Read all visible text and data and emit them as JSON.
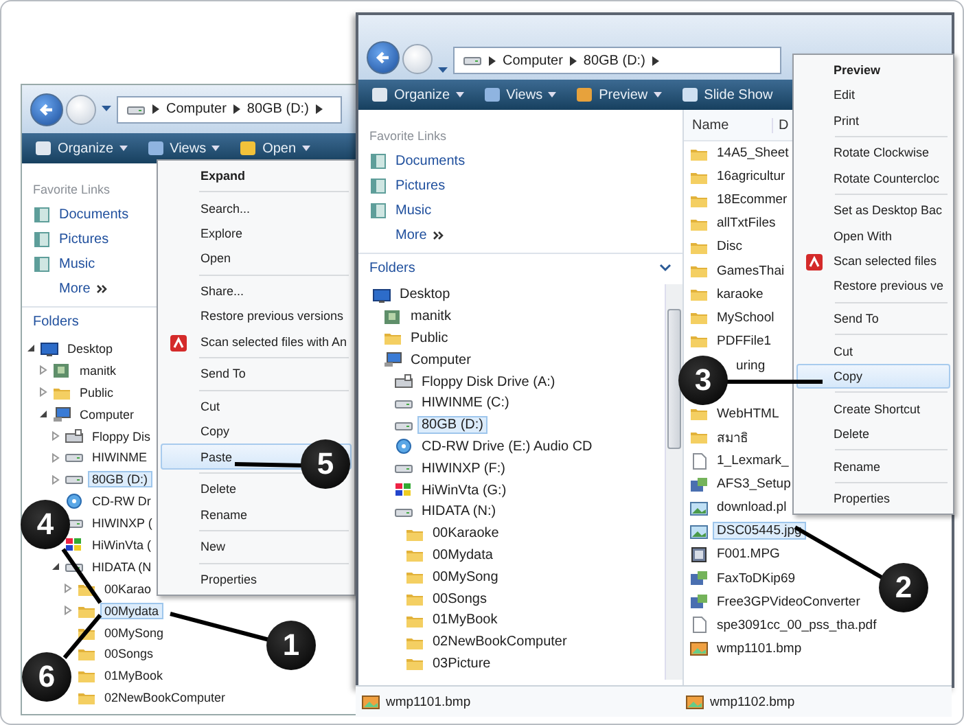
{
  "back_window": {
    "address": [
      "Computer",
      "80GB (D:)"
    ],
    "toolbar": [
      {
        "label": "Organize",
        "kind": "organize"
      },
      {
        "label": "Views",
        "kind": "views"
      },
      {
        "label": "Open",
        "kind": "open"
      }
    ],
    "favorite_links": {
      "title": "Favorite Links",
      "items": [
        "Documents",
        "Pictures",
        "Music"
      ],
      "more": "More"
    },
    "folders_title": "Folders",
    "tree": [
      {
        "label": "Desktop",
        "kind": "desktop",
        "expanded": true,
        "selected": false,
        "children": [
          {
            "label": "manitk",
            "kind": "user",
            "expanded": false,
            "selected": false
          },
          {
            "label": "Public",
            "kind": "folder",
            "expanded": false,
            "selected": false
          },
          {
            "label": "Computer",
            "kind": "computer",
            "expanded": true,
            "selected": false,
            "children": [
              {
                "label": "Floppy Dis",
                "kind": "floppy",
                "expanded": false,
                "selected": false
              },
              {
                "label": "HIWINME",
                "kind": "drive",
                "expanded": false,
                "selected": false
              },
              {
                "label": "80GB (D:)",
                "kind": "drive",
                "expanded": false,
                "selected": true
              },
              {
                "label": "CD-RW Dr",
                "kind": "cd",
                "selected": false
              },
              {
                "label": "HIWINXP (",
                "kind": "drive",
                "selected": false
              },
              {
                "label": "HiWinVta (",
                "kind": "system",
                "selected": false
              },
              {
                "label": "HIDATA (N",
                "kind": "drive",
                "expanded": true,
                "selected": false,
                "children": [
                  {
                    "label": "00Karao",
                    "kind": "folder",
                    "expanded": false,
                    "selected": false
                  },
                  {
                    "label": "00Mydata",
                    "kind": "folder",
                    "expanded": false,
                    "selected": true
                  },
                  {
                    "label": "00MySong",
                    "kind": "folder",
                    "selected": false
                  },
                  {
                    "label": "00Songs",
                    "kind": "folder",
                    "selected": false
                  },
                  {
                    "label": "01MyBook",
                    "kind": "folder",
                    "selected": false
                  },
                  {
                    "label": "02NewBookComputer",
                    "kind": "folder",
                    "selected": false
                  }
                ]
              }
            ]
          }
        ]
      }
    ]
  },
  "back_menu": {
    "groups": [
      [
        {
          "label": "Expand",
          "kind": "default",
          "selected": false
        }
      ],
      [
        {
          "label": "Search...",
          "kind": "plain",
          "selected": false
        },
        {
          "label": "Explore",
          "kind": "plain",
          "selected": false
        },
        {
          "label": "Open",
          "kind": "plain",
          "selected": false
        }
      ],
      [
        {
          "label": "Share...",
          "kind": "plain",
          "selected": false
        },
        {
          "label": "Restore previous versions",
          "kind": "plain",
          "selected": false
        },
        {
          "label": "Scan selected files with An",
          "kind": "scan",
          "selected": false
        }
      ],
      [
        {
          "label": "Send To",
          "kind": "plain",
          "selected": false
        }
      ],
      [
        {
          "label": "Cut",
          "kind": "plain",
          "selected": false
        },
        {
          "label": "Copy",
          "kind": "plain",
          "selected": false
        },
        {
          "label": "Paste",
          "kind": "plain",
          "selected": true
        }
      ],
      [
        {
          "label": "Delete",
          "kind": "plain",
          "selected": false
        },
        {
          "label": "Rename",
          "kind": "plain",
          "selected": false
        }
      ],
      [
        {
          "label": "New",
          "kind": "plain",
          "selected": false
        }
      ],
      [
        {
          "label": "Properties",
          "kind": "plain",
          "selected": false
        }
      ]
    ]
  },
  "front_window": {
    "address": [
      "Computer",
      "80GB (D:)"
    ],
    "toolbar": [
      {
        "label": "Organize",
        "kind": "organize"
      },
      {
        "label": "Views",
        "kind": "views"
      },
      {
        "label": "Preview",
        "kind": "preview"
      },
      {
        "label": "Slide Show",
        "kind": "slideshow"
      }
    ],
    "favorite_links": {
      "title": "Favorite Links",
      "items": [
        "Documents",
        "Pictures",
        "Music"
      ],
      "more": "More"
    },
    "folders_title": "Folders",
    "tree": [
      {
        "label": "Desktop",
        "kind": "desktop",
        "selected": false,
        "children": [
          {
            "label": "manitk",
            "kind": "user",
            "selected": false
          },
          {
            "label": "Public",
            "kind": "folder",
            "selected": false
          },
          {
            "label": "Computer",
            "kind": "computer",
            "selected": false,
            "children": [
              {
                "label": "Floppy Disk Drive (A:)",
                "kind": "floppy",
                "selected": false
              },
              {
                "label": "HIWINME (C:)",
                "kind": "drive",
                "selected": false
              },
              {
                "label": "80GB (D:)",
                "kind": "drive",
                "selected": true
              },
              {
                "label": "CD-RW Drive (E:) Audio CD",
                "kind": "cd",
                "selected": false
              },
              {
                "label": "HIWINXP (F:)",
                "kind": "drive",
                "selected": false
              },
              {
                "label": "HiWinVta (G:)",
                "kind": "system",
                "selected": false
              },
              {
                "label": "HIDATA (N:)",
                "kind": "drive",
                "selected": false,
                "children": [
                  {
                    "label": "00Karaoke",
                    "kind": "folder",
                    "selected": false
                  },
                  {
                    "label": "00Mydata",
                    "kind": "folder",
                    "selected": false
                  },
                  {
                    "label": "00MySong",
                    "kind": "folder",
                    "selected": false
                  },
                  {
                    "label": "00Songs",
                    "kind": "folder",
                    "selected": false
                  },
                  {
                    "label": "01MyBook",
                    "kind": "folder",
                    "selected": false
                  },
                  {
                    "label": "02NewBookComputer",
                    "kind": "folder",
                    "selected": false
                  },
                  {
                    "label": "03Picture",
                    "kind": "folder",
                    "selected": false
                  }
                ]
              }
            ]
          }
        ]
      }
    ],
    "columns": [
      "Name",
      "D"
    ],
    "files": [
      {
        "name": "14A5_Sheet",
        "kind": "folder",
        "selected": false
      },
      {
        "name": "16agricultur",
        "kind": "folder",
        "selected": false
      },
      {
        "name": "18Ecommer",
        "kind": "folder",
        "selected": false
      },
      {
        "name": "allTxtFiles",
        "kind": "folder",
        "selected": false
      },
      {
        "name": "Disc",
        "kind": "folder",
        "selected": false
      },
      {
        "name": "GamesThai",
        "kind": "folder",
        "selected": false
      },
      {
        "name": "karaoke",
        "kind": "folder",
        "selected": false
      },
      {
        "name": "MySchool",
        "kind": "folder",
        "selected": false
      },
      {
        "name": "PDFFile1",
        "kind": "folder",
        "selected": false
      },
      {
        "name": "uring",
        "kind": "covered",
        "selected": false
      },
      {
        "name": "WebHTML",
        "kind": "folder",
        "selected": false
      },
      {
        "name": "สมาธิ",
        "kind": "folder",
        "selected": false
      },
      {
        "name": "1_Lexmark_",
        "kind": "file",
        "selected": false
      },
      {
        "name": "AFS3_Setup",
        "kind": "setup",
        "selected": false
      },
      {
        "name": "download.pl",
        "kind": "image",
        "selected": false
      },
      {
        "name": "DSC05445.jpg",
        "kind": "image",
        "selected": true
      },
      {
        "name": "F001.MPG",
        "kind": "video",
        "selected": false
      },
      {
        "name": "FaxToDKip69",
        "kind": "setup",
        "selected": false
      },
      {
        "name": "Free3GPVideoConverter",
        "kind": "setup",
        "selected": false
      },
      {
        "name": "spe3091cc_00_pss_tha.pdf",
        "kind": "file",
        "selected": false
      },
      {
        "name": "wmp1101.bmp",
        "kind": "bitmap",
        "selected": false
      }
    ]
  },
  "front_menu": {
    "groups": [
      [
        {
          "label": "Preview",
          "kind": "default",
          "selected": false
        },
        {
          "label": "Edit",
          "kind": "plain",
          "selected": false
        },
        {
          "label": "Print",
          "kind": "plain",
          "selected": false
        }
      ],
      [
        {
          "label": "Rotate Clockwise",
          "kind": "plain",
          "selected": false
        },
        {
          "label": "Rotate Countercloc",
          "kind": "plain",
          "selected": false
        }
      ],
      [
        {
          "label": "Set as Desktop Bac",
          "kind": "plain",
          "selected": false
        },
        {
          "label": "Open With",
          "kind": "plain",
          "selected": false
        },
        {
          "label": "Scan selected files",
          "kind": "scan",
          "selected": false
        },
        {
          "label": "Restore previous ve",
          "kind": "plain",
          "selected": false
        }
      ],
      [
        {
          "label": "Send To",
          "kind": "plain",
          "selected": false
        }
      ],
      [
        {
          "label": "Cut",
          "kind": "plain",
          "selected": false
        },
        {
          "label": "Copy",
          "kind": "plain",
          "selected": true
        }
      ],
      [
        {
          "label": "Create Shortcut",
          "kind": "plain",
          "selected": false
        },
        {
          "label": "Delete",
          "kind": "plain",
          "selected": false
        }
      ],
      [
        {
          "label": "Rename",
          "kind": "plain",
          "selected": false
        }
      ],
      [
        {
          "label": "Properties",
          "kind": "plain",
          "selected": false
        }
      ]
    ]
  },
  "bottom_strip": [
    "wmp1101.bmp",
    "wmp1102.bmp"
  ],
  "callouts": [
    {
      "label": "1"
    },
    {
      "label": "2"
    },
    {
      "label": "3"
    },
    {
      "label": "4"
    },
    {
      "label": "5"
    },
    {
      "label": "6"
    }
  ]
}
